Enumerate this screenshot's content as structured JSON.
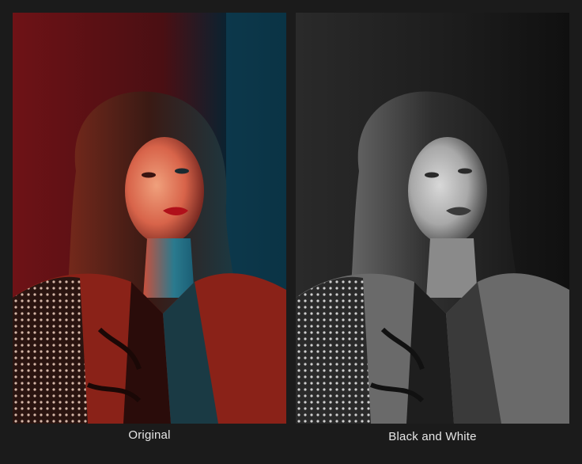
{
  "panels": [
    {
      "id": "original",
      "caption": "Original",
      "mode": "color"
    },
    {
      "id": "bw",
      "caption": "Black and White",
      "mode": "grayscale"
    }
  ],
  "colors": {
    "background": "#1b1b1b",
    "red_light": "#b3272a",
    "blue_light": "#0e5a78",
    "caption_text": "#e6e6e6"
  }
}
